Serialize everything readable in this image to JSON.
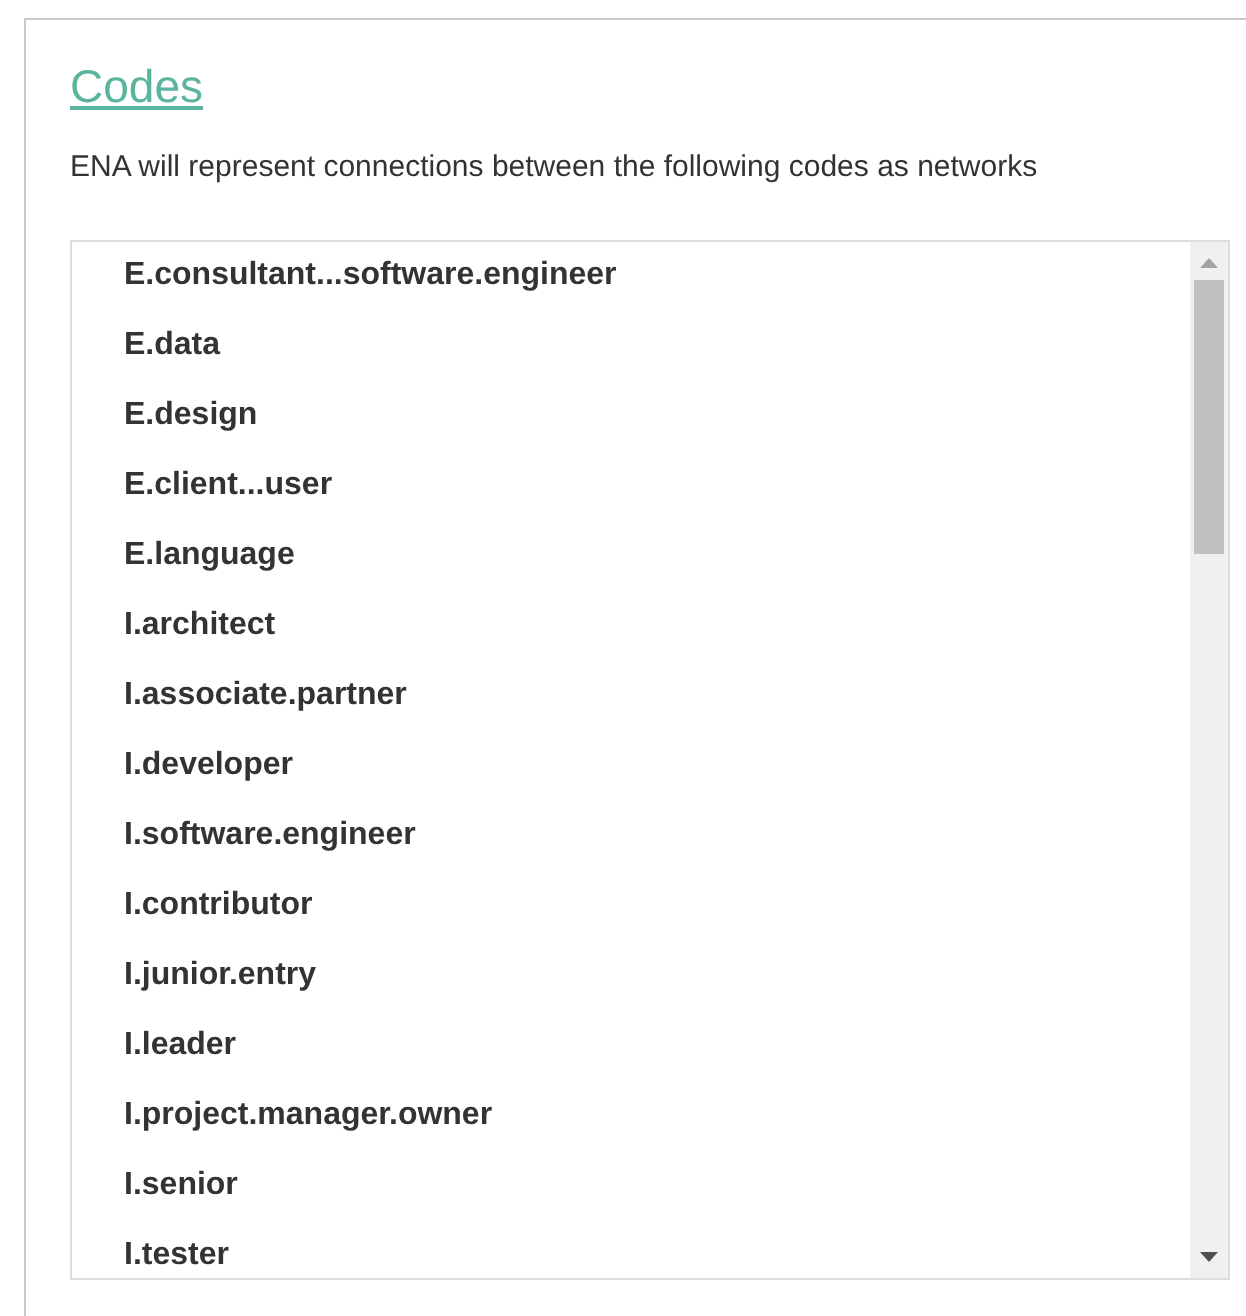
{
  "title": "Codes",
  "description": "ENA will represent connections between the following codes as networks",
  "codes": [
    "E.consultant...software.engineer",
    "E.data",
    "E.design",
    "E.client...user",
    "E.language",
    "I.architect",
    "I.associate.partner",
    "I.developer",
    "I.software.engineer",
    "I.contributor",
    "I.junior.entry",
    "I.leader",
    "I.project.manager.owner",
    "I.senior",
    "I.tester"
  ]
}
